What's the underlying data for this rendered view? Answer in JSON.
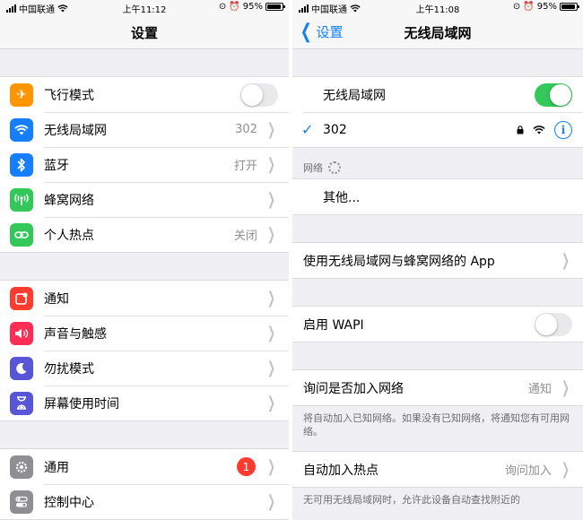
{
  "left": {
    "status": {
      "carrier": "中国联通",
      "time": "上午11:12",
      "battery": "95%"
    },
    "nav_title": "设置",
    "groups": [
      [
        {
          "label": "飞行模式",
          "icon": "airplane-icon",
          "color": "#ff9500",
          "accessory": "switch-off"
        },
        {
          "label": "无线局域网",
          "icon": "wifi-icon",
          "color": "#147efb",
          "value": "302"
        },
        {
          "label": "蓝牙",
          "icon": "bluetooth-icon",
          "color": "#147efb",
          "value": "打开"
        },
        {
          "label": "蜂窝网络",
          "icon": "antenna-icon",
          "color": "#34c759"
        },
        {
          "label": "个人热点",
          "icon": "hotspot-icon",
          "color": "#34c759",
          "value": "关闭"
        }
      ],
      [
        {
          "label": "通知",
          "icon": "notification-icon",
          "color": "#ff3b30"
        },
        {
          "label": "声音与触感",
          "icon": "speaker-icon",
          "color": "#ff2d55"
        },
        {
          "label": "勿扰模式",
          "icon": "moon-icon",
          "color": "#5856d6"
        },
        {
          "label": "屏幕使用时间",
          "icon": "hourglass-icon",
          "color": "#5856d6"
        }
      ],
      [
        {
          "label": "通用",
          "icon": "gear-icon",
          "color": "#8e8e93",
          "badge": "1"
        },
        {
          "label": "控制中心",
          "icon": "toggles-icon",
          "color": "#8e8e93"
        }
      ]
    ]
  },
  "right": {
    "status": {
      "carrier": "中国联通",
      "time": "上午11:08",
      "battery": "95%"
    },
    "nav_back": "设置",
    "nav_title": "无线局域网",
    "wifi_label": "无线局域网",
    "connected_network": "302",
    "networks_header": "网络",
    "other_label": "其他...",
    "apps_label": "使用无线局域网与蜂窝网络的 App",
    "wapi_label": "启用 WAPI",
    "ask_join_label": "询问是否加入网络",
    "ask_join_value": "通知",
    "ask_join_footer": "将自动加入已知网络。如果没有已知网络，将通知您有可用网络。",
    "auto_hotspot_label": "自动加入热点",
    "auto_hotspot_value": "询问加入",
    "auto_hotspot_footer": "无可用无线局域网时，允许此设备自动查找附近的"
  },
  "colors": {
    "accent": "#147efb",
    "switch_on": "#34c759"
  }
}
